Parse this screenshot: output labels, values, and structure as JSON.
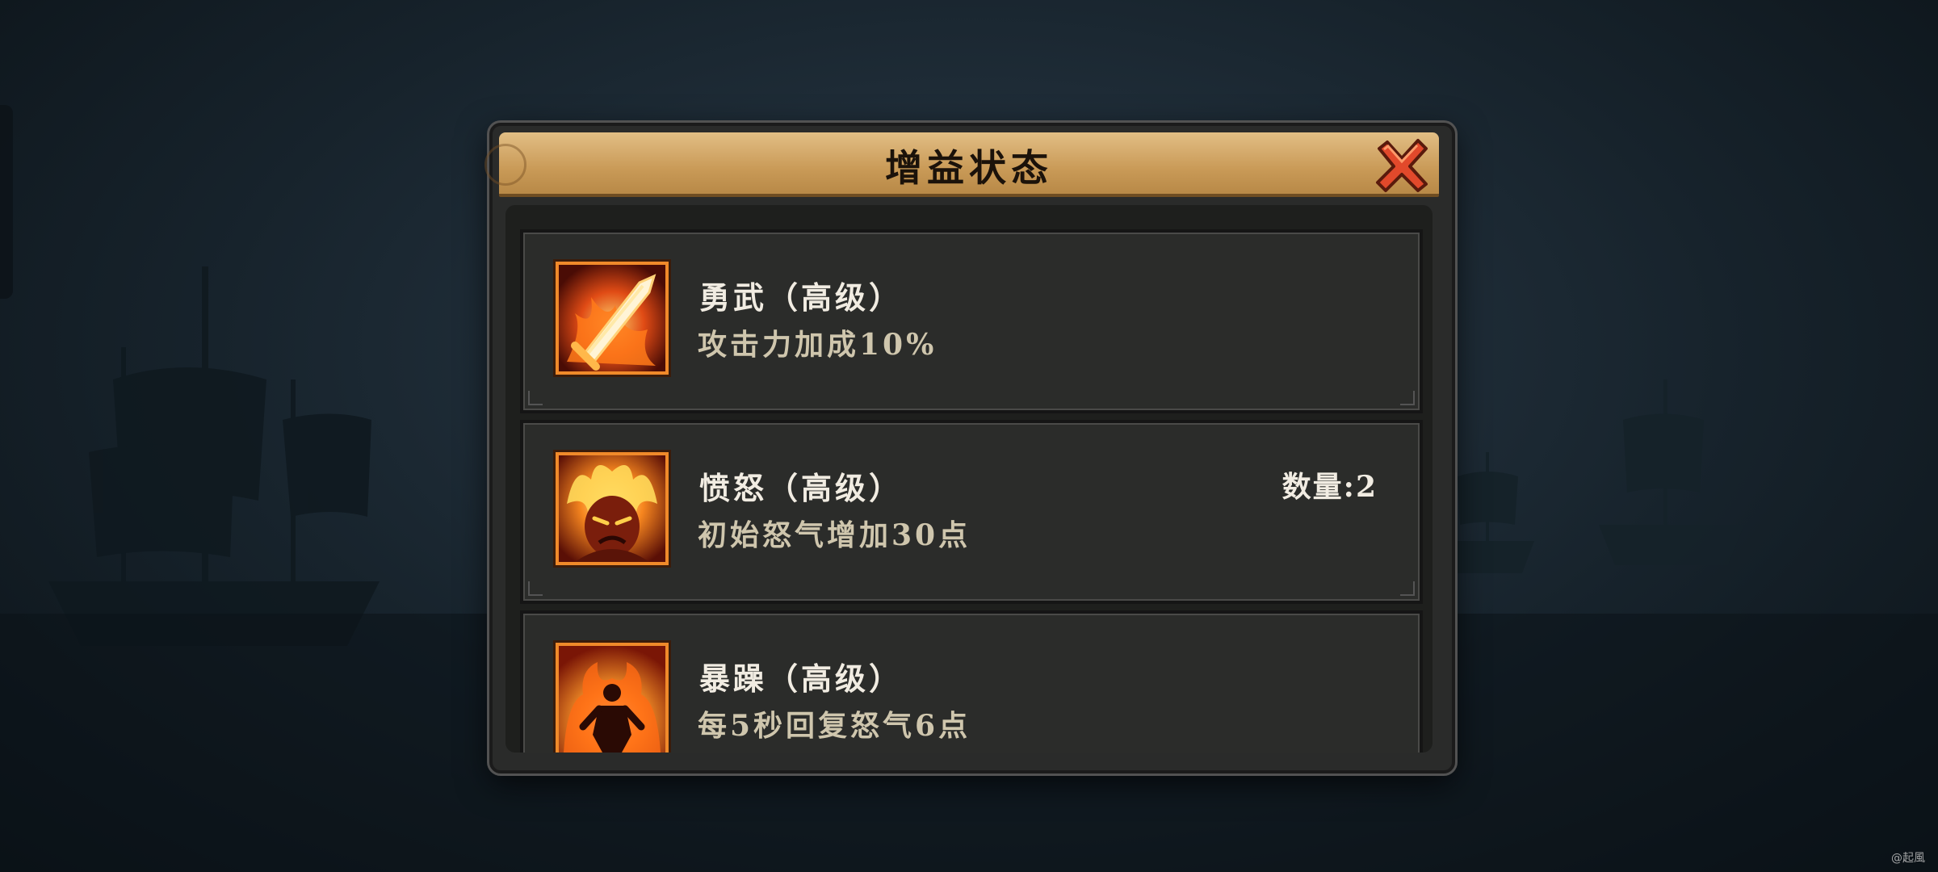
{
  "dialog": {
    "title": "增益状态",
    "close_icon": "close-x-icon"
  },
  "buffs": [
    {
      "name": "勇武（高级）",
      "description": "攻击力加成10%",
      "icon": "flaming-sword-icon",
      "count_label": ""
    },
    {
      "name": "愤怒（高级）",
      "description": "初始怒气增加30点",
      "icon": "rage-face-icon",
      "count_label": "数量:2"
    },
    {
      "name": "暴躁（高级）",
      "description": "每5秒回复怒气6点",
      "icon": "burning-warrior-icon",
      "count_label": ""
    }
  ],
  "watermark": "@起風",
  "colors": {
    "header_gold": "#d5aa6a",
    "icon_border": "#f08a2a",
    "panel": "#2b2c2a",
    "close_red": "#e2492b"
  }
}
